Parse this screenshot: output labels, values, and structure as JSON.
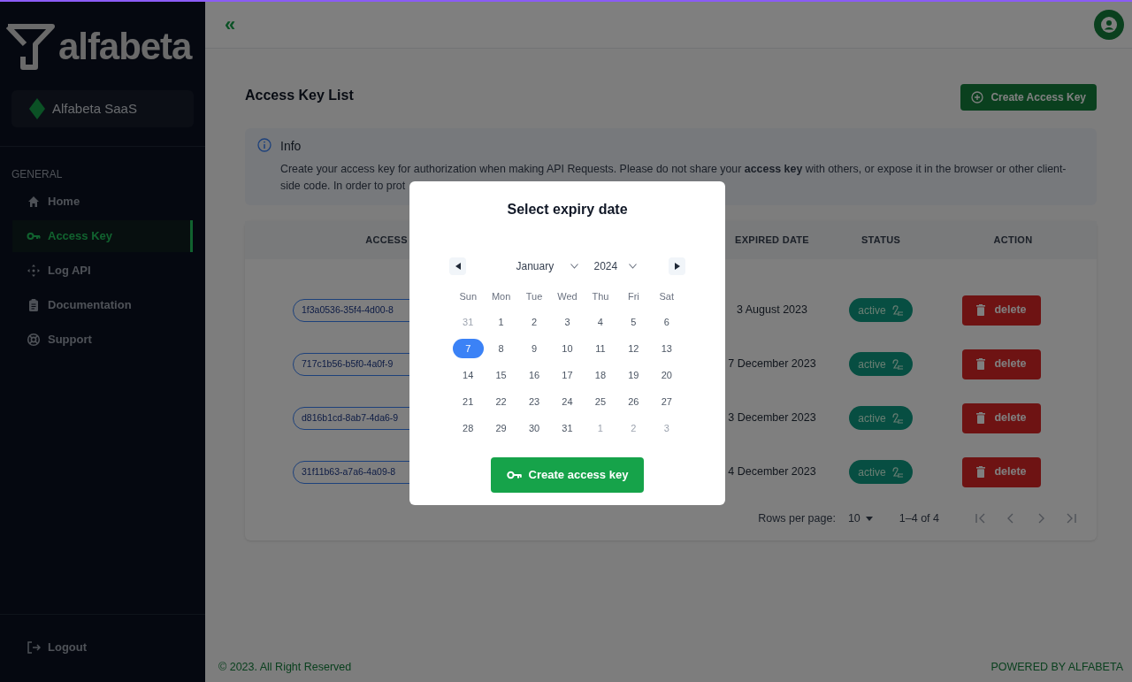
{
  "logo": {
    "text": "alfabeta"
  },
  "workspace": {
    "name": "Alfabeta SaaS"
  },
  "sidebar": {
    "section": "GENERAL",
    "items": [
      {
        "label": "Home",
        "selected": false
      },
      {
        "label": "Access Key",
        "selected": true
      },
      {
        "label": "Log API",
        "selected": false
      },
      {
        "label": "Documentation",
        "selected": false
      },
      {
        "label": "Support",
        "selected": false
      }
    ],
    "logout": "Logout"
  },
  "header": {
    "collapse": "«"
  },
  "page": {
    "title": "Access Key List",
    "create_button": "Create Access Key"
  },
  "info": {
    "title": "Info",
    "text": "Create your access key for authorization when making API Requests. Please do not share your **access key** with others, or expose it in the browser or other client-side code. In order to prot"
  },
  "table": {
    "columns": [
      "ACCESS",
      "EXPIRED DATE",
      "STATUS",
      "ACTION"
    ],
    "rows": [
      {
        "key": "1f3a0536-35f4-4d00-8",
        "expired": "3 August 2023",
        "status": "active",
        "action": "delete"
      },
      {
        "key": "717c1b56-b5f0-4a0f-9",
        "expired": "7 December 2023",
        "status": "active",
        "action": "delete"
      },
      {
        "key": "d816b1cd-8ab7-4da6-9",
        "expired": "3 December 2023",
        "status": "active",
        "action": "delete"
      },
      {
        "key": "31f11b63-a7a6-4a09-8",
        "expired": "4 December 2023",
        "status": "active",
        "action": "delete"
      }
    ],
    "pagination": {
      "rows_label": "Rows per page:",
      "rows_value": "10",
      "range": "1–4 of 4"
    }
  },
  "footer": {
    "copyright": "© 2023. All Right Reserved",
    "powered": "POWERED BY ALFABETA"
  },
  "modal": {
    "title": "Select expiry date",
    "month": "January",
    "year": "2024",
    "weekdays": [
      "Sun",
      "Mon",
      "Tue",
      "Wed",
      "Thu",
      "Fri",
      "Sat"
    ],
    "days": [
      {
        "label": "31",
        "outside": true,
        "selected": false
      },
      {
        "label": "1",
        "outside": false,
        "selected": false
      },
      {
        "label": "2",
        "outside": false,
        "selected": false
      },
      {
        "label": "3",
        "outside": false,
        "selected": false
      },
      {
        "label": "4",
        "outside": false,
        "selected": false
      },
      {
        "label": "5",
        "outside": false,
        "selected": false
      },
      {
        "label": "6",
        "outside": false,
        "selected": false
      },
      {
        "label": "7",
        "outside": false,
        "selected": true
      },
      {
        "label": "8",
        "outside": false,
        "selected": false
      },
      {
        "label": "9",
        "outside": false,
        "selected": false
      },
      {
        "label": "10",
        "outside": false,
        "selected": false
      },
      {
        "label": "11",
        "outside": false,
        "selected": false
      },
      {
        "label": "12",
        "outside": false,
        "selected": false
      },
      {
        "label": "13",
        "outside": false,
        "selected": false
      },
      {
        "label": "14",
        "outside": false,
        "selected": false
      },
      {
        "label": "15",
        "outside": false,
        "selected": false
      },
      {
        "label": "16",
        "outside": false,
        "selected": false
      },
      {
        "label": "17",
        "outside": false,
        "selected": false
      },
      {
        "label": "18",
        "outside": false,
        "selected": false
      },
      {
        "label": "19",
        "outside": false,
        "selected": false
      },
      {
        "label": "20",
        "outside": false,
        "selected": false
      },
      {
        "label": "21",
        "outside": false,
        "selected": false
      },
      {
        "label": "22",
        "outside": false,
        "selected": false
      },
      {
        "label": "23",
        "outside": false,
        "selected": false
      },
      {
        "label": "24",
        "outside": false,
        "selected": false
      },
      {
        "label": "25",
        "outside": false,
        "selected": false
      },
      {
        "label": "26",
        "outside": false,
        "selected": false
      },
      {
        "label": "27",
        "outside": false,
        "selected": false
      },
      {
        "label": "28",
        "outside": false,
        "selected": false
      },
      {
        "label": "29",
        "outside": false,
        "selected": false
      },
      {
        "label": "30",
        "outside": false,
        "selected": false
      },
      {
        "label": "31",
        "outside": false,
        "selected": false
      },
      {
        "label": "1",
        "outside": true,
        "selected": false
      },
      {
        "label": "2",
        "outside": true,
        "selected": false
      },
      {
        "label": "3",
        "outside": true,
        "selected": false
      }
    ],
    "submit": "Create access key"
  }
}
